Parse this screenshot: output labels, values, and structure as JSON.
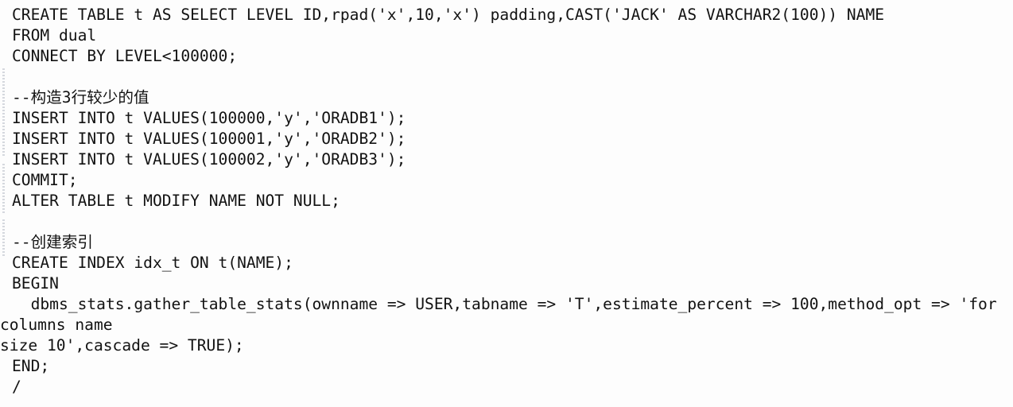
{
  "editor": {
    "language": "sql",
    "background_color": "#fdfdfd",
    "text_color": "#121212",
    "lines": [
      {
        "id": "line-1",
        "text": "CREATE TABLE t AS SELECT LEVEL ID,rpad('x',10,'x') padding,CAST('JACK' AS VARCHAR2(100)) NAME",
        "indent": "normal",
        "kind": "statement"
      },
      {
        "id": "line-2",
        "text": "FROM dual",
        "indent": "normal",
        "kind": "statement"
      },
      {
        "id": "line-3",
        "text": "CONNECT BY LEVEL<100000;",
        "indent": "normal",
        "kind": "statement"
      },
      {
        "id": "line-4",
        "text": "",
        "indent": "normal",
        "kind": "blank"
      },
      {
        "id": "line-5",
        "text": "--构造3行较少的值",
        "indent": "normal",
        "kind": "comment"
      },
      {
        "id": "line-6",
        "text": "INSERT INTO t VALUES(100000,'y','ORADB1');",
        "indent": "normal",
        "kind": "statement"
      },
      {
        "id": "line-7",
        "text": "INSERT INTO t VALUES(100001,'y','ORADB2');",
        "indent": "normal",
        "kind": "statement"
      },
      {
        "id": "line-8",
        "text": "INSERT INTO t VALUES(100002,'y','ORADB3');",
        "indent": "normal",
        "kind": "statement"
      },
      {
        "id": "line-9",
        "text": "COMMIT;",
        "indent": "normal",
        "kind": "statement"
      },
      {
        "id": "line-10",
        "text": "ALTER TABLE t MODIFY NAME NOT NULL;",
        "indent": "normal",
        "kind": "statement"
      },
      {
        "id": "line-11",
        "text": "",
        "indent": "normal",
        "kind": "blank"
      },
      {
        "id": "line-12",
        "text": "--创建索引",
        "indent": "normal",
        "kind": "comment"
      },
      {
        "id": "line-13",
        "text": "CREATE INDEX idx_t ON t(NAME);",
        "indent": "normal",
        "kind": "statement"
      },
      {
        "id": "line-14",
        "text": "BEGIN",
        "indent": "normal",
        "kind": "statement"
      },
      {
        "id": "line-15",
        "text": "  dbms_stats.gather_table_stats(ownname => USER,tabname => 'T',estimate_percent => 100,method_opt => 'for",
        "indent": "normal",
        "kind": "statement"
      },
      {
        "id": "line-16",
        "text": "columns name",
        "indent": "flush",
        "kind": "wrapped"
      },
      {
        "id": "line-17",
        "text": "size 10',cascade => TRUE);",
        "indent": "flush",
        "kind": "wrapped"
      },
      {
        "id": "line-18",
        "text": "END;",
        "indent": "normal",
        "kind": "statement"
      },
      {
        "id": "line-19",
        "text": "/",
        "indent": "normal",
        "kind": "statement"
      }
    ]
  }
}
